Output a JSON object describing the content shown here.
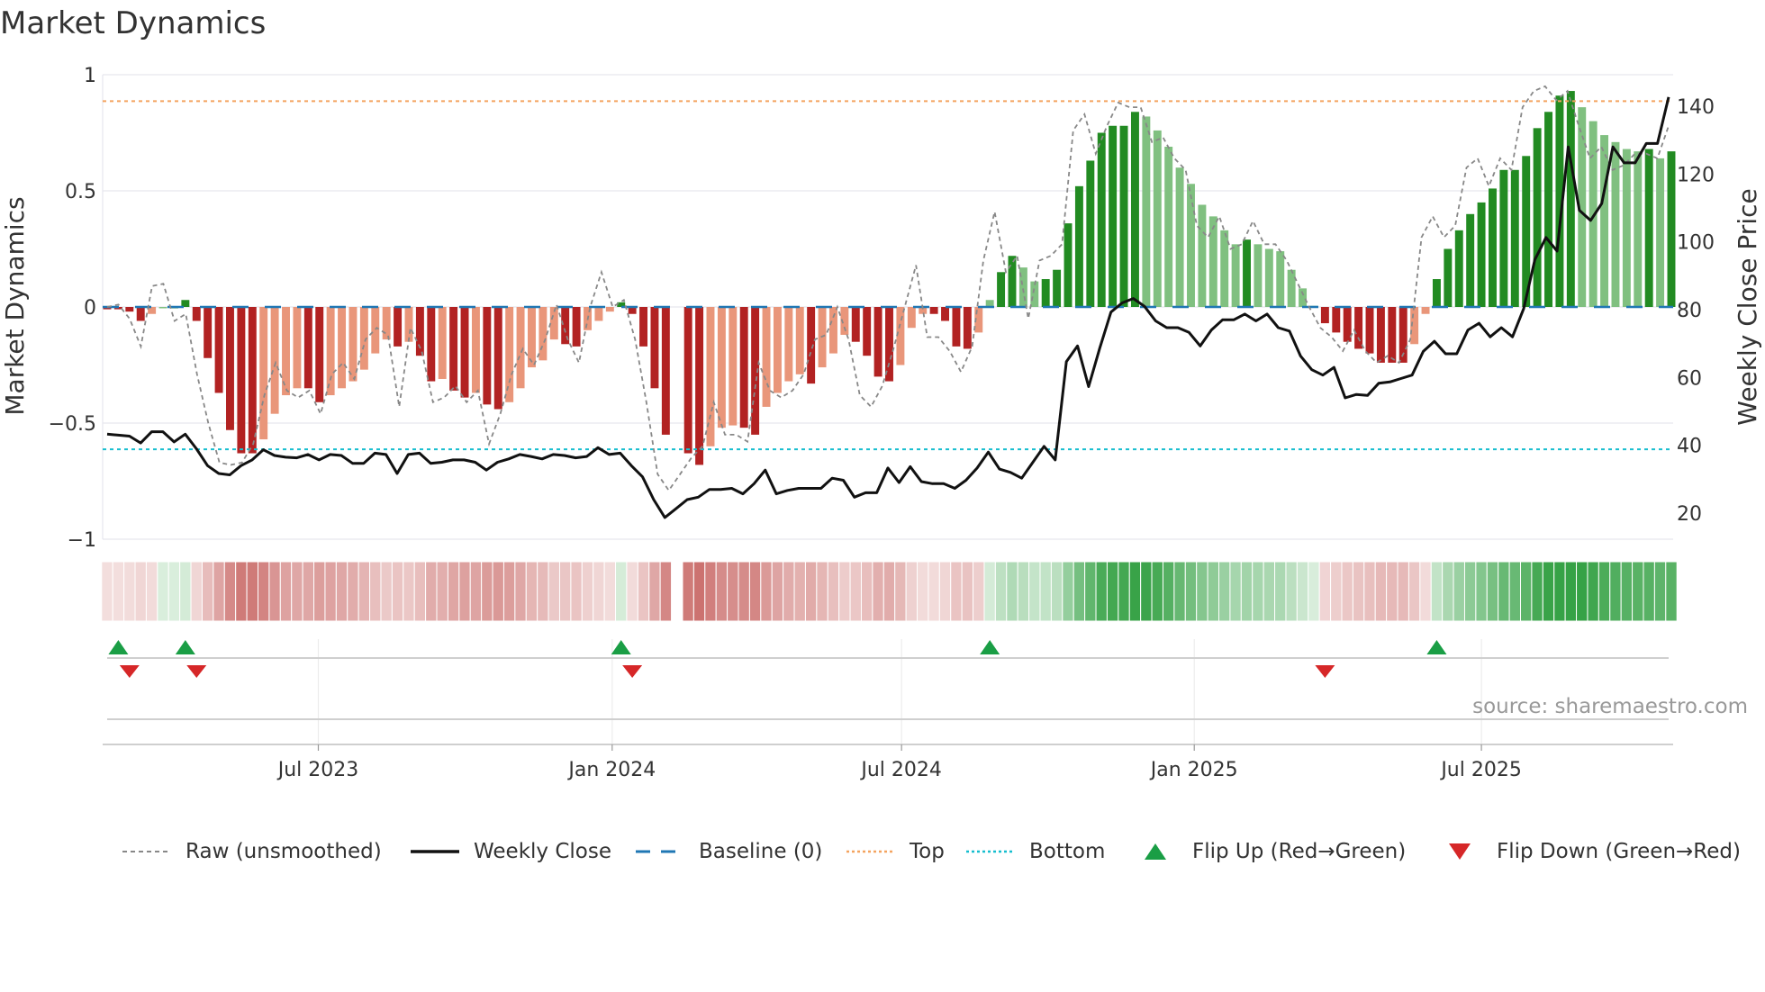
{
  "title": "Market Dynamics",
  "source": "source: sharemaestro.com",
  "colors": {
    "dark_red": "#b22222",
    "light_red": "#e9967a",
    "dark_green": "#228b22",
    "light_green": "#80c080",
    "strip_red": "#c0504d",
    "strip_green": "#2e9e3e",
    "raw": "#888888",
    "close": "#111111",
    "baseline": "#1f77b4",
    "top": "#f4a460",
    "bottom": "#17becf",
    "flip_up": "#1a9e45",
    "flip_down": "#d62728"
  },
  "chart_data": {
    "type": "bar",
    "title": "Market Dynamics",
    "ylabel": "Market Dynamics",
    "y2label": "Weekly Close Price",
    "ylim": [
      -1,
      1
    ],
    "y2lim": [
      12,
      148
    ],
    "yticks": [
      "1",
      "0.5",
      "0",
      "−0.5",
      "−1"
    ],
    "ytick_values": [
      1,
      0.5,
      0,
      -0.5,
      -1
    ],
    "y2ticks": [
      "140",
      "120",
      "100",
      "80",
      "60",
      "40",
      "20"
    ],
    "y2tick_values": [
      140,
      120,
      100,
      80,
      60,
      40,
      20
    ],
    "xticks": [
      "Jul 2023",
      "Jan 2024",
      "Jul 2024",
      "Jan 2025",
      "Jul 2025"
    ],
    "xtick_week_index": [
      18.9,
      45.2,
      71.1,
      97.3,
      123.0
    ],
    "top_level": 0.886,
    "bottom_level": -0.613,
    "baseline": 0,
    "grid": true,
    "legend_position": "bottom",
    "legend": [
      "Raw (unsmoothed)",
      "Weekly Close",
      "Baseline (0)",
      "Top",
      "Bottom",
      "Flip Up (Red→Green)",
      "Flip Down (Green→Red)"
    ],
    "smoothed": [
      -0.01,
      -0.01,
      -0.02,
      -0.06,
      -0.03,
      0,
      0,
      0.03,
      -0.06,
      -0.22,
      -0.37,
      -0.53,
      -0.63,
      -0.63,
      -0.57,
      -0.46,
      -0.38,
      -0.35,
      -0.35,
      -0.41,
      -0.38,
      -0.35,
      -0.32,
      -0.27,
      -0.2,
      -0.14,
      -0.17,
      -0.15,
      -0.21,
      -0.32,
      -0.31,
      -0.36,
      -0.39,
      -0.37,
      -0.42,
      -0.44,
      -0.41,
      -0.35,
      -0.26,
      -0.23,
      -0.14,
      -0.16,
      -0.17,
      -0.1,
      -0.06,
      -0.02,
      0.02,
      -0.03,
      -0.17,
      -0.35,
      -0.55,
      null,
      -0.63,
      -0.68,
      -0.6,
      -0.52,
      -0.51,
      -0.52,
      -0.55,
      -0.43,
      -0.37,
      -0.32,
      -0.29,
      -0.33,
      -0.26,
      -0.2,
      -0.12,
      -0.15,
      -0.21,
      -0.3,
      -0.32,
      -0.25,
      -0.09,
      -0.03,
      -0.03,
      -0.06,
      -0.17,
      -0.18,
      -0.11,
      0.03,
      0.15,
      0.22,
      0.17,
      0.11,
      0.12,
      0.16,
      0.36,
      0.52,
      0.63,
      0.75,
      0.78,
      0.78,
      0.84,
      0.82,
      0.76,
      0.69,
      0.6,
      0.53,
      0.44,
      0.39,
      0.33,
      0.27,
      0.29,
      0.27,
      0.25,
      0.24,
      0.16,
      0.08,
      0.005,
      -0.07,
      -0.11,
      -0.15,
      -0.18,
      -0.2,
      -0.24,
      -0.24,
      -0.24,
      -0.16,
      -0.03,
      0.12,
      0.25,
      0.33,
      0.4,
      0.45,
      0.51,
      0.59,
      0.59,
      0.65,
      0.77,
      0.84,
      0.91,
      0.93,
      0.86,
      0.8,
      0.74,
      0.71,
      0.68,
      0.67,
      0.68,
      0.64,
      0.67
    ],
    "raw": [
      0,
      0.01,
      -0.05,
      -0.17,
      0.09,
      0.1,
      -0.06,
      -0.03,
      -0.29,
      -0.5,
      -0.67,
      -0.68,
      -0.67,
      -0.59,
      -0.38,
      -0.24,
      -0.36,
      -0.39,
      -0.36,
      -0.46,
      -0.29,
      -0.24,
      -0.31,
      -0.14,
      -0.09,
      -0.12,
      -0.43,
      -0.09,
      -0.19,
      -0.41,
      -0.39,
      -0.34,
      -0.41,
      -0.36,
      -0.59,
      -0.46,
      -0.29,
      -0.18,
      -0.25,
      -0.14,
      0.01,
      -0.14,
      -0.24,
      0,
      0.15,
      0,
      0.03,
      -0.14,
      -0.41,
      -0.72,
      -0.79,
      -0.72,
      -0.65,
      -0.6,
      -0.41,
      -0.55,
      -0.55,
      -0.58,
      -0.24,
      -0.36,
      -0.39,
      -0.36,
      -0.29,
      -0.14,
      -0.12,
      0,
      -0.14,
      -0.38,
      -0.43,
      -0.34,
      -0.18,
      0,
      0.18,
      -0.13,
      -0.13,
      -0.19,
      -0.28,
      -0.17,
      0.2,
      0.41,
      0.15,
      0.22,
      -0.05,
      0.2,
      0.22,
      0.27,
      0.76,
      0.83,
      0.66,
      0.78,
      0.88,
      0.86,
      0.86,
      0.71,
      0.73,
      0.64,
      0.59,
      0.35,
      0.3,
      0.39,
      0.25,
      0.27,
      0.37,
      0.27,
      0.27,
      0.2,
      0.1,
      0,
      -0.09,
      -0.13,
      -0.19,
      -0.1,
      -0.19,
      -0.24,
      -0.21,
      -0.24,
      -0.14,
      0.3,
      0.39,
      0.3,
      0.35,
      0.6,
      0.64,
      0.52,
      0.64,
      0.59,
      0.86,
      0.93,
      0.95,
      0.89,
      0.93,
      0.78,
      0.64,
      0.69,
      0.59,
      0.61,
      0.66,
      0.66,
      0.64,
      0.78
    ],
    "weekly_close": [
      43.3,
      43,
      42.7,
      40.7,
      44,
      44,
      41,
      43.3,
      39,
      34,
      31.7,
      31.3,
      34,
      35.7,
      38.7,
      37,
      36.5,
      36.3,
      37.3,
      35.7,
      37.3,
      37,
      34.7,
      34.7,
      37.7,
      37.3,
      31.7,
      37.3,
      37.7,
      34.7,
      35,
      35.7,
      35.7,
      35,
      32.7,
      35,
      36,
      37.3,
      36.7,
      36,
      37.3,
      37,
      36.3,
      36.7,
      39.3,
      37.3,
      37.7,
      34,
      30.7,
      24,
      18.7,
      21.3,
      24,
      24.7,
      27,
      27,
      27.3,
      25.7,
      28.7,
      32.7,
      25.7,
      26.7,
      27.3,
      27.3,
      27.3,
      30.3,
      29.7,
      24.7,
      26,
      26,
      33.3,
      29,
      33.7,
      29.3,
      28.7,
      28.7,
      27.3,
      29.7,
      33.3,
      38,
      33,
      32,
      30.3,
      35,
      39.7,
      35.7,
      64.7,
      69.3,
      57.3,
      68.7,
      79.3,
      82,
      83.3,
      81,
      76.7,
      74.7,
      74.7,
      73.3,
      69.3,
      74,
      77,
      77,
      78.7,
      76.7,
      78.7,
      74.7,
      73.7,
      66.3,
      62.3,
      60.7,
      63,
      54,
      55,
      54.7,
      58.3,
      58.7,
      59.7,
      60.7,
      67.7,
      70.7,
      67,
      67,
      74,
      76,
      72,
      74.7,
      72,
      80.3,
      94.7,
      101.3,
      97.3,
      128,
      109.3,
      106.3,
      111.3,
      128,
      123.3,
      123.3,
      129,
      129,
      142.7
    ],
    "flip_up_week_index": [
      1,
      7,
      46,
      79,
      119
    ],
    "flip_down_week_index": [
      2,
      8,
      47,
      109
    ]
  }
}
